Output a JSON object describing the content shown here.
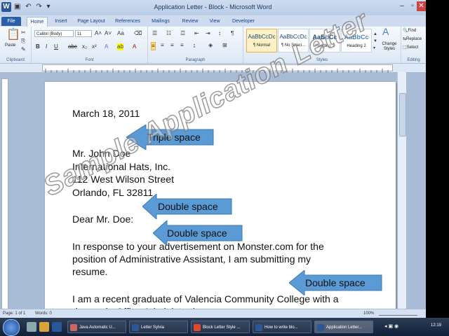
{
  "window": {
    "title": "Application Letter - Block  -  Microsoft Word"
  },
  "tabs": [
    "File",
    "Home",
    "Insert",
    "Page Layout",
    "References",
    "Mailings",
    "Review",
    "View",
    "Developer"
  ],
  "ribbon": {
    "clipboard": {
      "paste_label": "Paste",
      "group_label": "Clipboard"
    },
    "font": {
      "font_name": "Calibri (Body)",
      "font_size": "11",
      "group_label": "Font"
    },
    "paragraph": {
      "group_label": "Paragraph"
    },
    "styles": {
      "items": [
        {
          "preview": "AaBbCcDc",
          "name": "¶ Normal"
        },
        {
          "preview": "AaBbCcDc",
          "name": "¶ No Spaci..."
        },
        {
          "preview": "AaBbCc",
          "name": "Heading 1"
        },
        {
          "preview": "AaBbCc",
          "name": "Heading 2"
        }
      ],
      "change_styles_label": "Change Styles",
      "group_label": "Styles"
    },
    "editing": {
      "find_label": "Find",
      "replace_label": "Replace",
      "select_label": "Select",
      "group_label": "Editing"
    }
  },
  "document": {
    "date": "March 18, 2011",
    "address_lines": [
      "Mr. John Doe",
      "International Hats, Inc.",
      "112 West Wilson Street",
      "Orlando, FL 32811"
    ],
    "salutation": "Dear Mr. Doe:",
    "paragraph1_lines": [
      "In response to your advertisement on Monster.com for the",
      "position of Administrative Assistant, I am submitting my",
      "resume."
    ],
    "paragraph2_lines": [
      "I am a recent graduate of Valencia Community College with a",
      "degree in Office Administration."
    ]
  },
  "annotations": {
    "arrow1": "Triple space",
    "arrow2": "Double space",
    "arrow3": "Double space",
    "arrow4": "Double space",
    "watermark": "Sample Application Letter",
    "arrow_color": "#5b9bd5"
  },
  "statusbar": {
    "page": "Page: 1 of 1",
    "words": "Words: 0",
    "zoom": "100%"
  },
  "taskbar": {
    "items": [
      "Java Automatic U...",
      "Letter Sylvia",
      "Block Letter Style ...",
      "How to write blo...",
      "Application Letter..."
    ],
    "clock": "12:19"
  }
}
